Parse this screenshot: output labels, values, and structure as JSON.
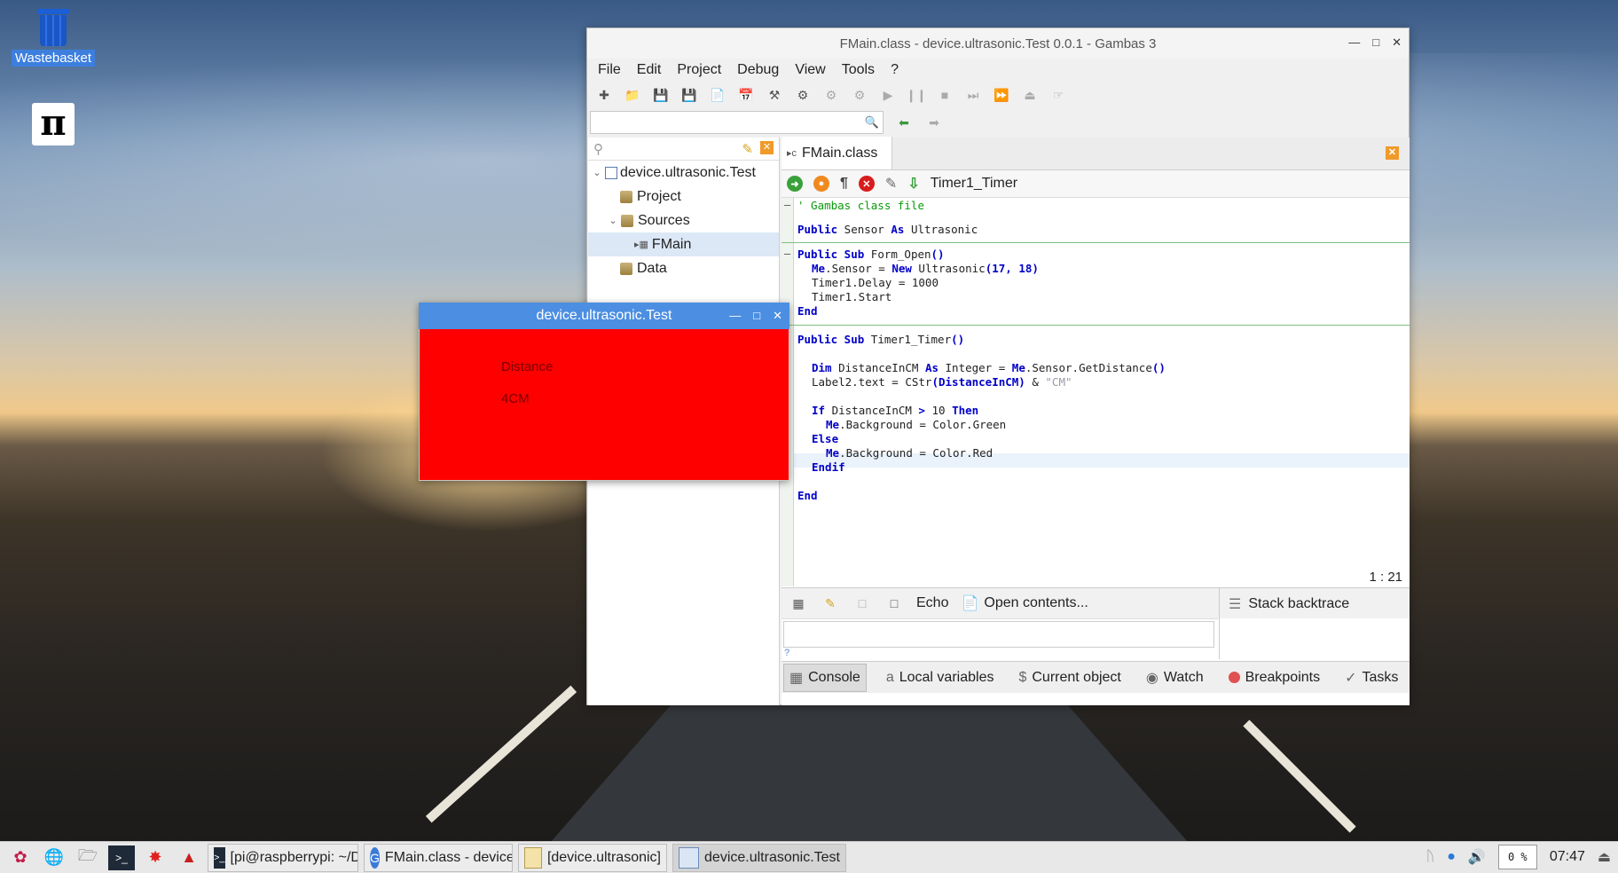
{
  "desktop": {
    "icons": [
      {
        "label": "Wastebasket",
        "icon": "trash-icon"
      },
      {
        "label": "",
        "icon": "gpio-icon",
        "glyph": "π"
      }
    ]
  },
  "ide": {
    "title": "FMain.class - device.ultrasonic.Test 0.0.1 - Gambas 3",
    "menu": [
      "File",
      "Edit",
      "Project",
      "Debug",
      "View",
      "Tools",
      "?"
    ],
    "tree": {
      "root": "device.ultrasonic.Test",
      "project": "Project",
      "sources": "Sources",
      "fmain": "FMain",
      "data": "Data"
    },
    "tab_label": "FMain.class",
    "proc_selector": "Timer1_Timer",
    "code": {
      "l1": "' Gambas class file",
      "l2a": "Public",
      "l2b": " Sensor ",
      "l2c": "As",
      "l2d": " Ultrasonic",
      "l3a": "Public Sub",
      "l3b": " Form_Open",
      "l3c": "()",
      "l4a": "Me",
      "l4b": ".Sensor = ",
      "l4c": "New",
      "l4d": " Ultrasonic",
      "l4e": "(17, 18)",
      "l5": "Timer1.Delay = 1000",
      "l6": "Timer1.Start",
      "l7": "End",
      "l8a": "Public Sub",
      "l8b": " Timer1_Timer",
      "l8c": "()",
      "l9a": "Dim",
      "l9b": " DistanceInCM ",
      "l9c": "As",
      "l9d": " Integer = ",
      "l9e": "Me",
      "l9f": ".Sensor.GetDistance",
      "l9g": "()",
      "l10a": "Label2.text = CStr",
      "l10b": "(DistanceInCM)",
      "l10c": " & ",
      "l10d": "\"CM\"",
      "l11a": "If",
      "l11b": " DistanceInCM ",
      "l11c": ">",
      "l11d": " 10 ",
      "l11e": "Then",
      "l12a": "Me",
      "l12b": ".Background = Color.Green",
      "l13": "Else",
      "l14a": "Me",
      "l14b": ".Background = Color.Red",
      "l15": "Endif",
      "l16": "End"
    },
    "cursor_pos": "1 : 21",
    "bottom_tools": {
      "echo": "Echo",
      "open_contents": "Open contents...",
      "stack_backtrace": "Stack backtrace"
    },
    "console_prompt": "?",
    "bottom_tabs": [
      "Console",
      "Local variables",
      "Current object",
      "Watch",
      "Breakpoints",
      "Tasks"
    ]
  },
  "form": {
    "title": "device.ultrasonic.Test",
    "label_distance": "Distance",
    "label_value": "4CM",
    "background": "#ff0000"
  },
  "taskbar": {
    "tasks": [
      {
        "label": "[pi@raspberrypi: ~/D...",
        "icon": "terminal-icon"
      },
      {
        "label": "FMain.class - device....",
        "icon": "gambas-icon"
      },
      {
        "label": "[device.ultrasonic]",
        "icon": "folder-icon"
      },
      {
        "label": "device.ultrasonic.Test",
        "icon": "window-icon"
      }
    ],
    "cpu": "0 %",
    "clock": "07:47"
  }
}
